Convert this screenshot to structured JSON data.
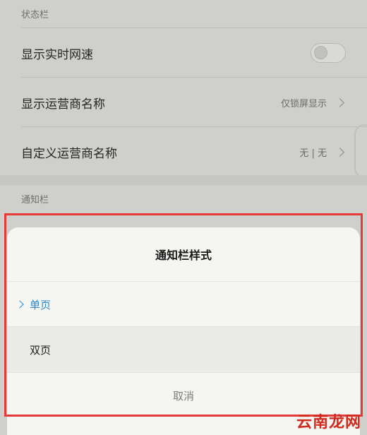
{
  "status_bar_section": {
    "header": "状态栏",
    "rows": [
      {
        "label": "显示实时网速",
        "type": "toggle",
        "toggle_on": false
      },
      {
        "label": "显示运营商名称",
        "value": "仅锁屏显示"
      },
      {
        "label": "自定义运营商名称",
        "value": "无 | 无"
      }
    ]
  },
  "notification_section": {
    "header": "通知栏"
  },
  "dialog": {
    "title": "通知栏样式",
    "options": [
      {
        "label": "单页",
        "selected": true
      },
      {
        "label": "双页",
        "selected": false
      }
    ],
    "cancel_label": "取消"
  },
  "colors": {
    "accent": "#2a86c9",
    "highlight_frame": "#e63a3a",
    "watermark": "#d12a1d"
  },
  "watermark": "云南龙网"
}
